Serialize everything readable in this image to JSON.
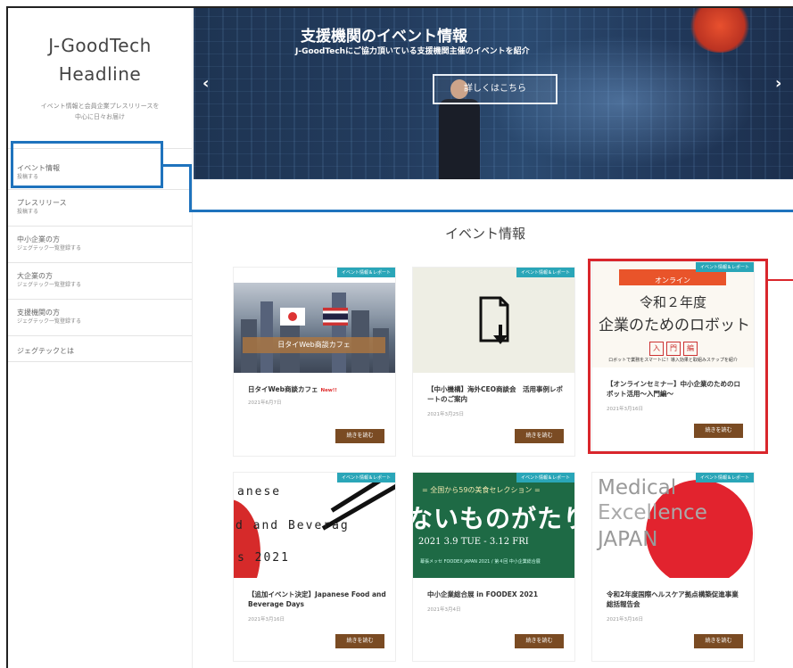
{
  "site": {
    "logo_line1": "J-GoodTech",
    "logo_line2": "Headline",
    "tagline_line1": "イベント情報と会員企業プレスリリースを",
    "tagline_line2": "中心に日々お届け"
  },
  "sidebar": {
    "items": [
      {
        "label": "イベント情報",
        "sub": "投稿する"
      },
      {
        "label": "プレスリリース",
        "sub": "投稿する"
      },
      {
        "label": "中小企業の方",
        "sub": "ジェグテック一覧登録する"
      },
      {
        "label": "大企業の方",
        "sub": "ジェグテック一覧登録する"
      },
      {
        "label": "支援機関の方",
        "sub": "ジェグテック一覧登録する"
      },
      {
        "label": "ジェグテックとは",
        "sub": ""
      }
    ]
  },
  "banner": {
    "title": "支援機関のイベント情報",
    "subtitle": "J-GoodTechにご協力頂いている支援機関主催のイベントを紹介",
    "button": "詳しくはこちら",
    "prev_icon": "chevron-left-icon",
    "next_icon": "chevron-right-icon"
  },
  "section": {
    "title": "イベント情報"
  },
  "cards": [
    {
      "badge": "イベント情報＆レポート",
      "title": "日タイWeb商談カフェ",
      "new_label": "New!!",
      "date": "2021年6月7日",
      "more": "続きを読む",
      "thumb": {
        "band": "日タイWeb商談カフェ"
      }
    },
    {
      "badge": "イベント情報＆レポート",
      "title": "【中小機構】海外CEO商談会　活用事例レポートのご案内",
      "new_label": "",
      "date": "2021年3月25日",
      "more": "続きを読む",
      "thumb": {}
    },
    {
      "badge": "イベント情報＆レポート",
      "title": "【オンラインセミナー】中小企業のためのロボット活用～入門編～",
      "new_label": "",
      "date": "2021年3月16日",
      "more": "続きを読む",
      "thumb": {
        "top": "オンライン",
        "l1": "令和２年度",
        "l2": "企業のためのロボット",
        "boxes": [
          "入",
          "門",
          "編"
        ],
        "l3": "ロボットで業務をスマートに！導入効果と取組みステップを紹介"
      }
    },
    {
      "badge": "イベント情報＆レポート",
      "title": "【追加イベント決定】Japanese Food and Beverage Days",
      "new_label": "",
      "date": "2021年3月16日",
      "more": "続きを読む",
      "thumb": {
        "w1": "anese",
        "w2": "d and Beverag",
        "w3": "s 2021"
      }
    },
    {
      "badge": "イベント情報＆レポート",
      "title": "中小企業総合展 in FOODEX 2021",
      "new_label": "",
      "date": "2021年3月4日",
      "more": "続きを読む",
      "thumb": {
        "hdr": "= 全国から59の美食セレクション =",
        "big": "ないものがたり",
        "dt": "2021 3.9 TUE - 3.12 FRI",
        "ft": "幕張メッセ FOODEX JAPAN 2021 / 第４回 中小企業総合展"
      }
    },
    {
      "badge": "イベント情報＆レポート",
      "title": "令和2年度国際ヘルスケア拠点構築促進事業　総括報告会",
      "new_label": "",
      "date": "2021年3月16日",
      "more": "続きを読む",
      "thumb": {
        "w1": "Medical",
        "w2": "Excellence",
        "w3": "JAPAN"
      }
    }
  ]
}
